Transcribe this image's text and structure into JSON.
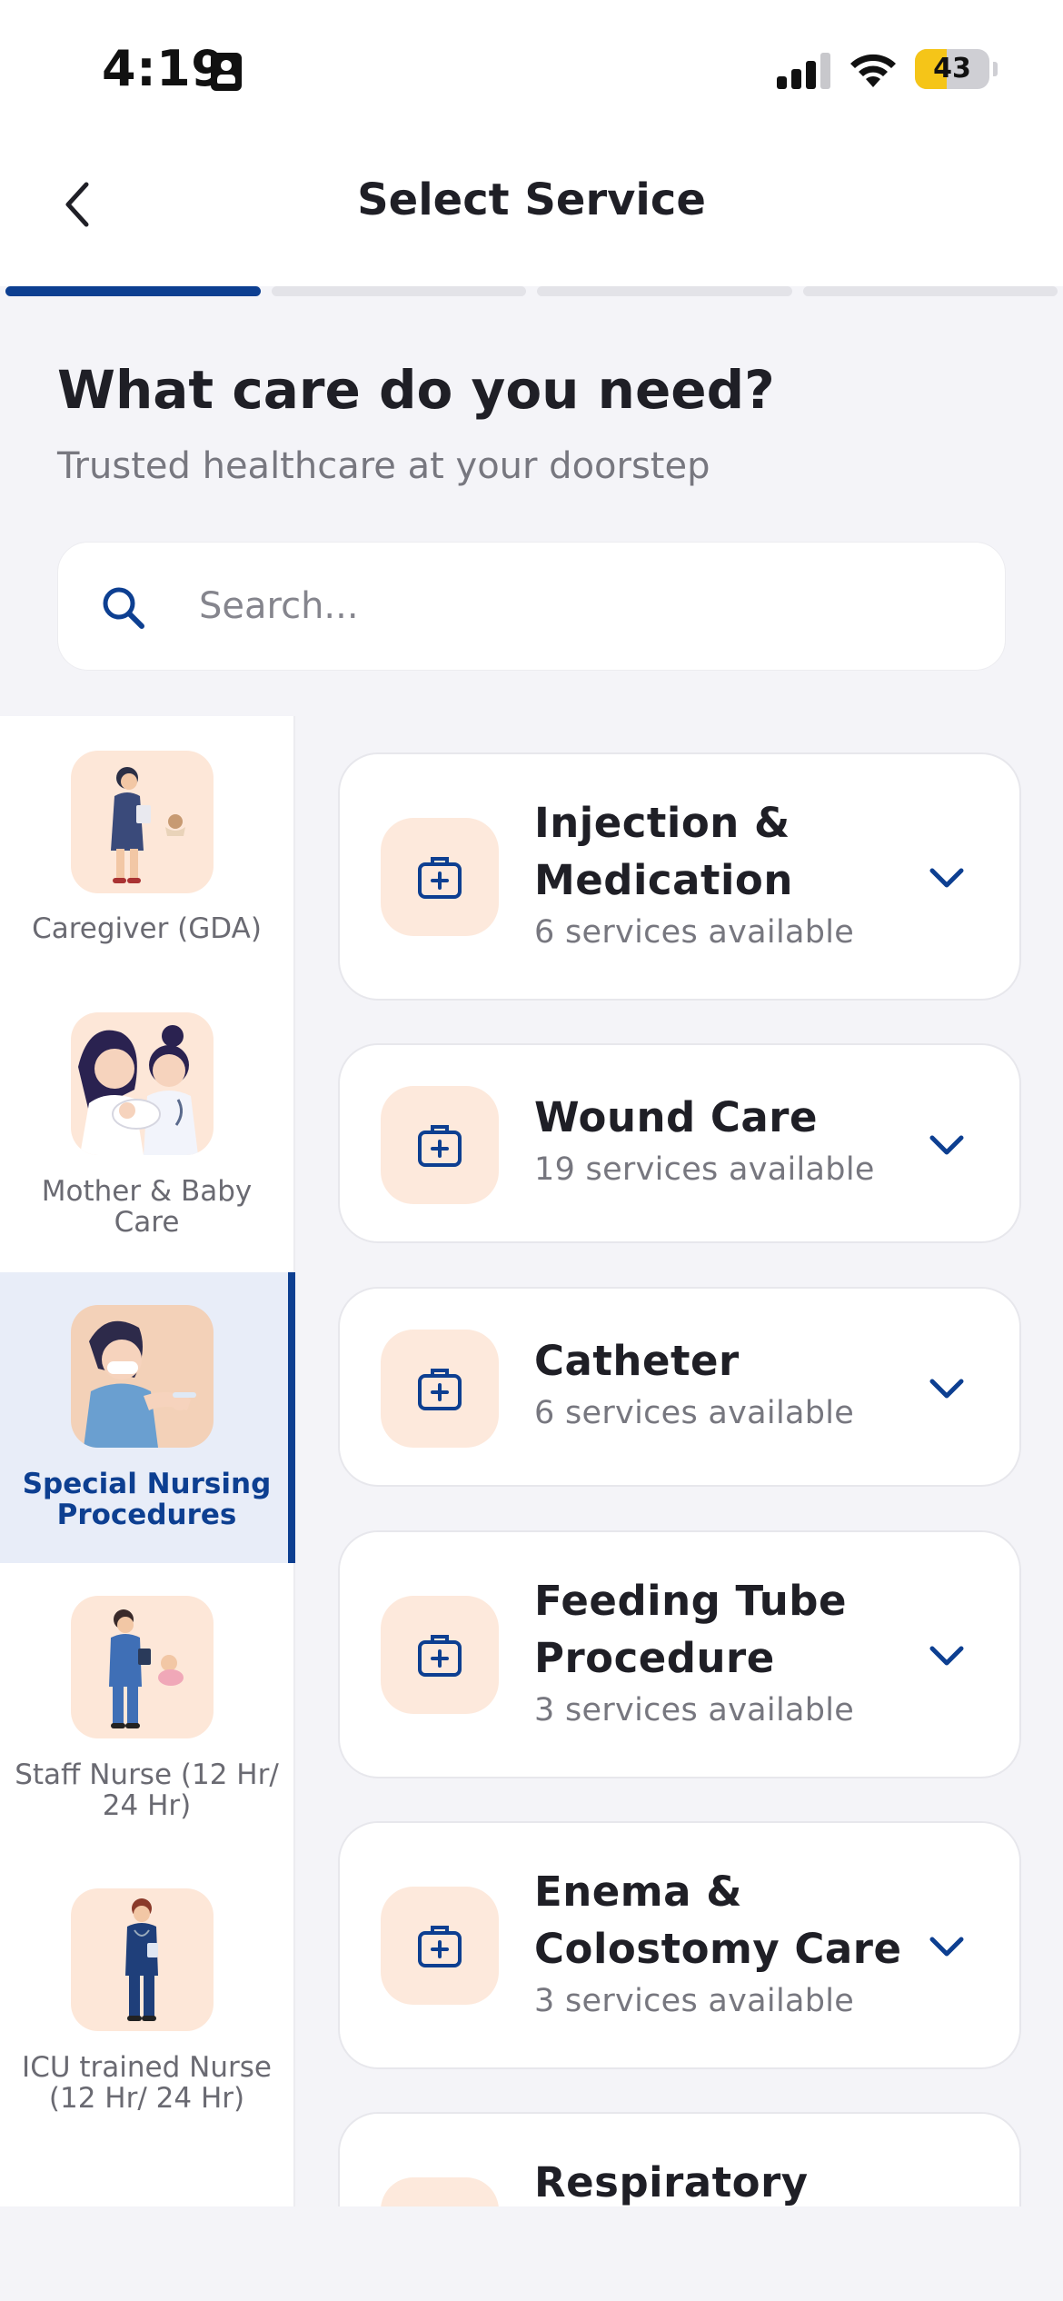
{
  "status_bar": {
    "time": "4:19",
    "battery": "43",
    "battery_level": 0.43,
    "colors": {
      "battery_fill": "#f5c518"
    }
  },
  "header": {
    "title": "Select Service",
    "back_icon": "chevron-left-icon",
    "steps_total": 4,
    "steps_active": 1
  },
  "intro": {
    "heading": "What care do you need?",
    "subheading": "Trusted healthcare at your doorstep"
  },
  "search": {
    "placeholder": "Search...",
    "value": "",
    "icon": "search-icon"
  },
  "sidebar": {
    "items": [
      {
        "label": "Caregiver (GDA)",
        "active": false
      },
      {
        "label": "Mother & Baby Care",
        "active": false
      },
      {
        "label": "Special Nursing Procedures",
        "active": true
      },
      {
        "label": "Staff Nurse (12 Hr/ 24 Hr)",
        "active": false
      },
      {
        "label": "ICU trained Nurse (12 Hr/ 24 Hr)",
        "active": false
      }
    ]
  },
  "services": [
    {
      "title": "Injection & Medication",
      "count": "6 services available",
      "icon": "medical-kit-icon"
    },
    {
      "title": "Wound Care",
      "count": "19 services available",
      "icon": "medical-kit-icon"
    },
    {
      "title": "Catheter",
      "count": "6 services available",
      "icon": "medical-kit-icon"
    },
    {
      "title": "Feeding Tube Procedure",
      "count": "3 services available",
      "icon": "medical-kit-icon"
    },
    {
      "title": "Enema & Colostomy Care",
      "count": "3 services available",
      "icon": "medical-kit-icon"
    },
    {
      "title": "Respiratory",
      "count": "",
      "icon": "medical-kit-icon"
    }
  ],
  "colors": {
    "brand": "#0d3f91",
    "icon_bg": "#fde9dc",
    "active_bg": "#e8edf8"
  }
}
